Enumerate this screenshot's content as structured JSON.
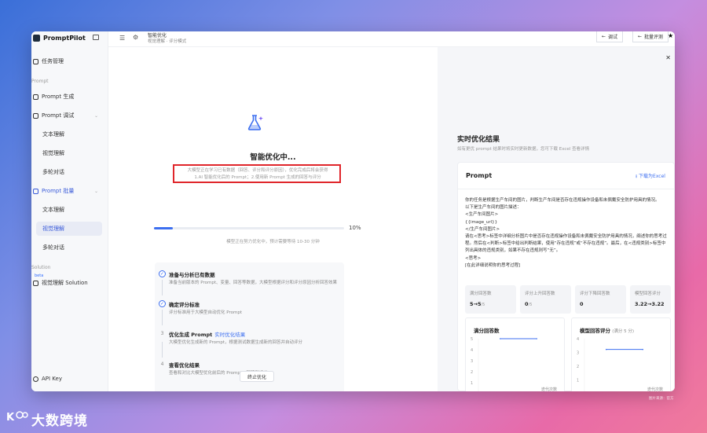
{
  "sidebar": {
    "brand": "PromptPilot",
    "task_mgmt": "任务管理",
    "group_prompt": "Prompt",
    "prompt_gen": "Prompt 生成",
    "prompt_debug": "Prompt 调试",
    "debug_subs": [
      "文本理解",
      "视觉理解",
      "多轮对话"
    ],
    "prompt_batch": "Prompt 批量",
    "batch_subs": [
      "文本理解",
      "视觉理解",
      "多轮对话"
    ],
    "group_solution": "Solution",
    "beta": "beta",
    "solution_item": "视觉理解 Solution",
    "api_key": "API Key"
  },
  "topbar": {
    "title": "智能优化",
    "subtitle": "视觉理解 · 评分模式",
    "btn_debug": "调试",
    "btn_batch_eval": "批量评测"
  },
  "main": {
    "title": "智能优化中...",
    "desc_line1": "大模型正在学习已有数据（回答、评分和评分原因），优化完成后将会获得",
    "desc_line2": "1.AI 智能优化后的 Prompt；2.使用新 Prompt 生成的回答与评分",
    "progress_label": "10%",
    "progress": 0.1,
    "progress_note": "模型正在努力优化中，预计需要等待 10-30 分钟",
    "steps": [
      {
        "title": "准备与分析已有数据",
        "link": "",
        "desc": "准备当前版本的 Prompt、变量、回答等数据，大模型根据评分和评分原因分析回答效果",
        "status": "done"
      },
      {
        "title": "确定评分标准",
        "link": "",
        "desc": "评分标准用于大模型自动优化 Prompt",
        "status": "done"
      },
      {
        "title": "优化生成 Prompt",
        "link": "实时优化结果",
        "desc": "大模型优化生成新的 Prompt，根据测试数据生成新的回答并自动评分",
        "status": "running"
      },
      {
        "title": "查看优化结果",
        "link": "",
        "desc": "查看和对比大模型优化前后的 Prompt、回答和评分",
        "status": "pending"
      }
    ],
    "step_numbers": [
      "",
      "",
      "3",
      "4"
    ],
    "stop_button": "终止优化"
  },
  "result": {
    "title": "实时优化结果",
    "subtitle": "如有更优 prompt 结果时将实时更新数据，您可下载 Excel 查看详情",
    "card_title": "Prompt",
    "download": "下载为Excel",
    "prompt_lines": [
      "你的任务是根据生产车间的图片，判断生产车间是否存在违规操作设备和未佩戴安全防护用具的情况。",
      "以下是生产车间的图片描述：",
      "<生产车间图片>",
      "{{image_url}}",
      "</生产车间图片>",
      "请在<思考>标签中详细分析图片中是否存在违规操作设备和未佩戴安全防护用具的情况，阐述你的思考过程。然后在<判断>标签中给出判断结果，使用“存在违规”或“不存在违规”。最后，在<违规类别>标签中列出具体的违规类别，如果不存在违规则写“无”。",
      "<思考>",
      "[在此详细说明你的思考过程]"
    ],
    "stats": [
      {
        "label": "满分回答数",
        "value": "5→5",
        "suffix": "/5"
      },
      {
        "label": "评分上升回答数",
        "value": "0",
        "suffix": "/5"
      },
      {
        "label": "评分下降回答数",
        "value": "0",
        "suffix": ""
      },
      {
        "label": "模型回答评分",
        "value": "3.22→3.22",
        "suffix": ""
      }
    ],
    "charts": [
      {
        "title": "满分回答数",
        "unit": "",
        "y_ticks": [
          "5",
          "4",
          "3",
          "2",
          "1",
          "0"
        ],
        "x_ticks": [
          "1",
          "2"
        ],
        "x_label": "迭代次数"
      },
      {
        "title": "模型回答评分",
        "unit": "(满分 5 分)",
        "y_ticks": [
          "4",
          "3",
          "2",
          "1",
          "0"
        ],
        "x_ticks": [
          "1",
          "2"
        ],
        "x_label": "迭代次数"
      }
    ]
  },
  "chart_data": [
    {
      "type": "line",
      "title": "满分回答数",
      "xlabel": "迭代次数",
      "x": [
        1,
        2
      ],
      "y": [
        5,
        5
      ],
      "ylim": [
        0,
        5
      ]
    },
    {
      "type": "line",
      "title": "模型回答评分",
      "xlabel": "迭代次数",
      "x": [
        1,
        2
      ],
      "y": [
        3.22,
        3.22
      ],
      "ylim": [
        0,
        4
      ]
    }
  ],
  "watermark": "大数跨境",
  "corner_mark": "图片来源：官方",
  "colors": {
    "accent": "#3d6ff0",
    "highlight": "#e0262b"
  }
}
